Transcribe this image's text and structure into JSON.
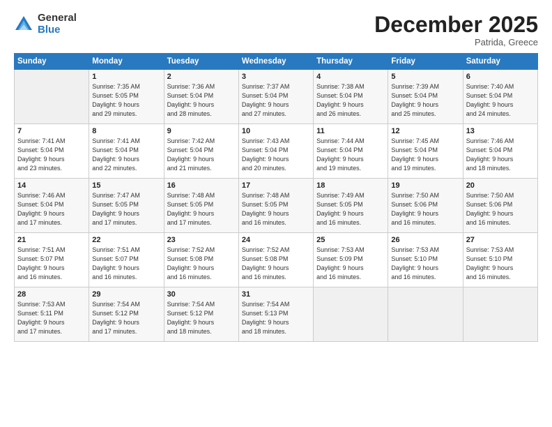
{
  "header": {
    "logo_general": "General",
    "logo_blue": "Blue",
    "month_title": "December 2025",
    "location": "Patrida, Greece"
  },
  "days_of_week": [
    "Sunday",
    "Monday",
    "Tuesday",
    "Wednesday",
    "Thursday",
    "Friday",
    "Saturday"
  ],
  "weeks": [
    [
      {
        "day": "",
        "info": ""
      },
      {
        "day": "1",
        "info": "Sunrise: 7:35 AM\nSunset: 5:05 PM\nDaylight: 9 hours\nand 29 minutes."
      },
      {
        "day": "2",
        "info": "Sunrise: 7:36 AM\nSunset: 5:04 PM\nDaylight: 9 hours\nand 28 minutes."
      },
      {
        "day": "3",
        "info": "Sunrise: 7:37 AM\nSunset: 5:04 PM\nDaylight: 9 hours\nand 27 minutes."
      },
      {
        "day": "4",
        "info": "Sunrise: 7:38 AM\nSunset: 5:04 PM\nDaylight: 9 hours\nand 26 minutes."
      },
      {
        "day": "5",
        "info": "Sunrise: 7:39 AM\nSunset: 5:04 PM\nDaylight: 9 hours\nand 25 minutes."
      },
      {
        "day": "6",
        "info": "Sunrise: 7:40 AM\nSunset: 5:04 PM\nDaylight: 9 hours\nand 24 minutes."
      }
    ],
    [
      {
        "day": "7",
        "info": "Sunrise: 7:41 AM\nSunset: 5:04 PM\nDaylight: 9 hours\nand 23 minutes."
      },
      {
        "day": "8",
        "info": "Sunrise: 7:41 AM\nSunset: 5:04 PM\nDaylight: 9 hours\nand 22 minutes."
      },
      {
        "day": "9",
        "info": "Sunrise: 7:42 AM\nSunset: 5:04 PM\nDaylight: 9 hours\nand 21 minutes."
      },
      {
        "day": "10",
        "info": "Sunrise: 7:43 AM\nSunset: 5:04 PM\nDaylight: 9 hours\nand 20 minutes."
      },
      {
        "day": "11",
        "info": "Sunrise: 7:44 AM\nSunset: 5:04 PM\nDaylight: 9 hours\nand 19 minutes."
      },
      {
        "day": "12",
        "info": "Sunrise: 7:45 AM\nSunset: 5:04 PM\nDaylight: 9 hours\nand 19 minutes."
      },
      {
        "day": "13",
        "info": "Sunrise: 7:46 AM\nSunset: 5:04 PM\nDaylight: 9 hours\nand 18 minutes."
      }
    ],
    [
      {
        "day": "14",
        "info": "Sunrise: 7:46 AM\nSunset: 5:04 PM\nDaylight: 9 hours\nand 17 minutes."
      },
      {
        "day": "15",
        "info": "Sunrise: 7:47 AM\nSunset: 5:05 PM\nDaylight: 9 hours\nand 17 minutes."
      },
      {
        "day": "16",
        "info": "Sunrise: 7:48 AM\nSunset: 5:05 PM\nDaylight: 9 hours\nand 17 minutes."
      },
      {
        "day": "17",
        "info": "Sunrise: 7:48 AM\nSunset: 5:05 PM\nDaylight: 9 hours\nand 16 minutes."
      },
      {
        "day": "18",
        "info": "Sunrise: 7:49 AM\nSunset: 5:05 PM\nDaylight: 9 hours\nand 16 minutes."
      },
      {
        "day": "19",
        "info": "Sunrise: 7:50 AM\nSunset: 5:06 PM\nDaylight: 9 hours\nand 16 minutes."
      },
      {
        "day": "20",
        "info": "Sunrise: 7:50 AM\nSunset: 5:06 PM\nDaylight: 9 hours\nand 16 minutes."
      }
    ],
    [
      {
        "day": "21",
        "info": "Sunrise: 7:51 AM\nSunset: 5:07 PM\nDaylight: 9 hours\nand 16 minutes."
      },
      {
        "day": "22",
        "info": "Sunrise: 7:51 AM\nSunset: 5:07 PM\nDaylight: 9 hours\nand 16 minutes."
      },
      {
        "day": "23",
        "info": "Sunrise: 7:52 AM\nSunset: 5:08 PM\nDaylight: 9 hours\nand 16 minutes."
      },
      {
        "day": "24",
        "info": "Sunrise: 7:52 AM\nSunset: 5:08 PM\nDaylight: 9 hours\nand 16 minutes."
      },
      {
        "day": "25",
        "info": "Sunrise: 7:53 AM\nSunset: 5:09 PM\nDaylight: 9 hours\nand 16 minutes."
      },
      {
        "day": "26",
        "info": "Sunrise: 7:53 AM\nSunset: 5:10 PM\nDaylight: 9 hours\nand 16 minutes."
      },
      {
        "day": "27",
        "info": "Sunrise: 7:53 AM\nSunset: 5:10 PM\nDaylight: 9 hours\nand 16 minutes."
      }
    ],
    [
      {
        "day": "28",
        "info": "Sunrise: 7:53 AM\nSunset: 5:11 PM\nDaylight: 9 hours\nand 17 minutes."
      },
      {
        "day": "29",
        "info": "Sunrise: 7:54 AM\nSunset: 5:12 PM\nDaylight: 9 hours\nand 17 minutes."
      },
      {
        "day": "30",
        "info": "Sunrise: 7:54 AM\nSunset: 5:12 PM\nDaylight: 9 hours\nand 18 minutes."
      },
      {
        "day": "31",
        "info": "Sunrise: 7:54 AM\nSunset: 5:13 PM\nDaylight: 9 hours\nand 18 minutes."
      },
      {
        "day": "",
        "info": ""
      },
      {
        "day": "",
        "info": ""
      },
      {
        "day": "",
        "info": ""
      }
    ]
  ]
}
